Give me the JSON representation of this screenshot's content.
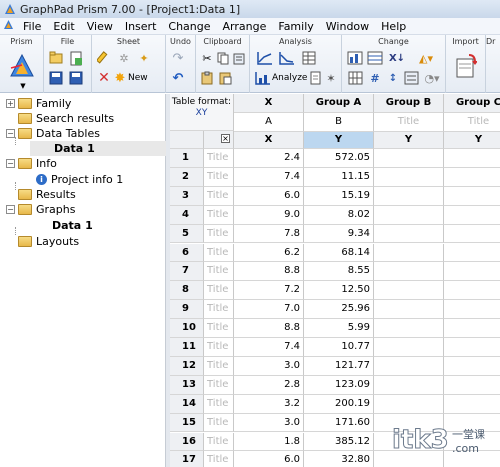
{
  "window": {
    "title": "GraphPad Prism 7.00 - [Project1:Data 1]"
  },
  "menu": [
    "File",
    "Edit",
    "View",
    "Insert",
    "Change",
    "Arrange",
    "Family",
    "Window",
    "Help"
  ],
  "ribbon": {
    "groups": [
      "Prism",
      "File",
      "Sheet",
      "Undo",
      "Clipboard",
      "Analysis",
      "Change",
      "Import",
      "Dr"
    ],
    "new_label": "New",
    "analyze_label": "Analyze"
  },
  "navigator": {
    "items": [
      {
        "label": "Family",
        "kind": "folder"
      },
      {
        "label": "Search results",
        "kind": "folder"
      },
      {
        "label": "Data Tables",
        "kind": "folder"
      },
      {
        "label": "Data 1",
        "kind": "sheet",
        "selected": true
      },
      {
        "label": "Info",
        "kind": "folder"
      },
      {
        "label": "Project info 1",
        "kind": "info"
      },
      {
        "label": "Results",
        "kind": "folder"
      },
      {
        "label": "Graphs",
        "kind": "folder"
      },
      {
        "label": "Data 1",
        "kind": "graph"
      },
      {
        "label": "Layouts",
        "kind": "folder"
      }
    ]
  },
  "table": {
    "format_label": "Table format:",
    "format_value": "XY",
    "columns": [
      {
        "group": "X",
        "letter": "A",
        "sub": "X"
      },
      {
        "group": "Group A",
        "letter": "B",
        "sub": "Y"
      },
      {
        "group": "Group B",
        "letter": "Title",
        "sub": "Y"
      },
      {
        "group": "Group C",
        "letter": "Title",
        "sub": "Y"
      }
    ],
    "title_placeholder": "Title",
    "rows": [
      {
        "n": "1",
        "x": "2.4",
        "y": "572.05"
      },
      {
        "n": "2",
        "x": "7.4",
        "y": "11.15"
      },
      {
        "n": "3",
        "x": "6.0",
        "y": "15.19"
      },
      {
        "n": "4",
        "x": "9.0",
        "y": "8.02"
      },
      {
        "n": "5",
        "x": "7.8",
        "y": "9.34"
      },
      {
        "n": "6",
        "x": "6.2",
        "y": "68.14"
      },
      {
        "n": "7",
        "x": "8.8",
        "y": "8.55"
      },
      {
        "n": "8",
        "x": "7.2",
        "y": "12.50"
      },
      {
        "n": "9",
        "x": "7.0",
        "y": "25.96"
      },
      {
        "n": "10",
        "x": "8.8",
        "y": "5.99"
      },
      {
        "n": "11",
        "x": "7.4",
        "y": "10.77"
      },
      {
        "n": "12",
        "x": "3.0",
        "y": "121.77"
      },
      {
        "n": "13",
        "x": "2.8",
        "y": "123.09"
      },
      {
        "n": "14",
        "x": "3.2",
        "y": "200.19"
      },
      {
        "n": "15",
        "x": "3.0",
        "y": "171.60"
      },
      {
        "n": "16",
        "x": "1.8",
        "y": "385.12"
      },
      {
        "n": "17",
        "x": "6.0",
        "y": "32.80"
      }
    ]
  },
  "watermark": {
    "text": "itk3.com",
    "cn": "一堂课"
  }
}
